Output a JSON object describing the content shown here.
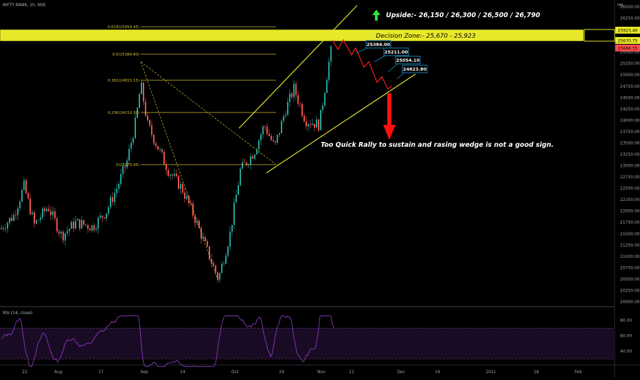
{
  "header": {
    "symbol_title": "NIFTY BANK, 1h, NSE"
  },
  "annotations": {
    "upside": "Upside:- 26,150 / 26,300 / 26,500 / 26,790",
    "decision_zone": "Decision Zone:- 25,670 - 25,923",
    "note": "Too Quick Rally to sustain and rasing wedge is not a good sign.",
    "targets": [
      "25384.00",
      "25211.00",
      "25054.10",
      "24823.80"
    ]
  },
  "fib_levels": [
    {
      "label": "0.618(25954.45)",
      "price": 25954.45
    },
    {
      "label": "0.5(25384.80)",
      "price": 25384.8
    },
    {
      "label": "0.382(24815.15)",
      "price": 24815.15
    },
    {
      "label": "0.236(24110.30)",
      "price": 24110.3
    },
    {
      "label": "0(22970.95)",
      "price": 22970.95
    }
  ],
  "price_tags": [
    "25923.40",
    "25670.75",
    "25666.35"
  ],
  "price_axis": {
    "ticks": [
      "26500.00",
      "26250.00",
      "26000.00",
      "25750.00",
      "25500.00",
      "25250.00",
      "25000.00",
      "24750.00",
      "24500.00",
      "24250.00",
      "24000.00",
      "23750.00",
      "23500.00",
      "23250.00",
      "23000.00",
      "22750.00",
      "22500.00",
      "22250.00",
      "22000.00",
      "21750.00",
      "21500.00",
      "21250.00",
      "21000.00",
      "20750.00",
      "20500.00",
      "20250.00",
      "20000.00"
    ],
    "top_label": "INR"
  },
  "rsi": {
    "title": "RSI (14, close)",
    "ticks": [
      "80.00",
      "60.00",
      "40.00"
    ],
    "upper": 70,
    "lower": 30
  },
  "time_axis": [
    "22",
    "Aug",
    "17",
    "Sep",
    "14",
    "Oct",
    "19",
    "Nov",
    "11",
    "Dec",
    "14",
    "2021",
    "18",
    "Feb"
  ],
  "colors": {
    "background": "#000000",
    "zone": "#e8e82a",
    "fib": "#d4c234",
    "wedge": "#e8e82a",
    "path": "#ff2020",
    "up_arrow": "#2ee62e",
    "down_arrow": "#ff1010",
    "target_box": "#1e90c8",
    "rsi_line": "#9b3fd6",
    "rsi_band": "#1a0b25",
    "candle_up": "#26a69a",
    "candle_down": "#ef5350"
  }
}
